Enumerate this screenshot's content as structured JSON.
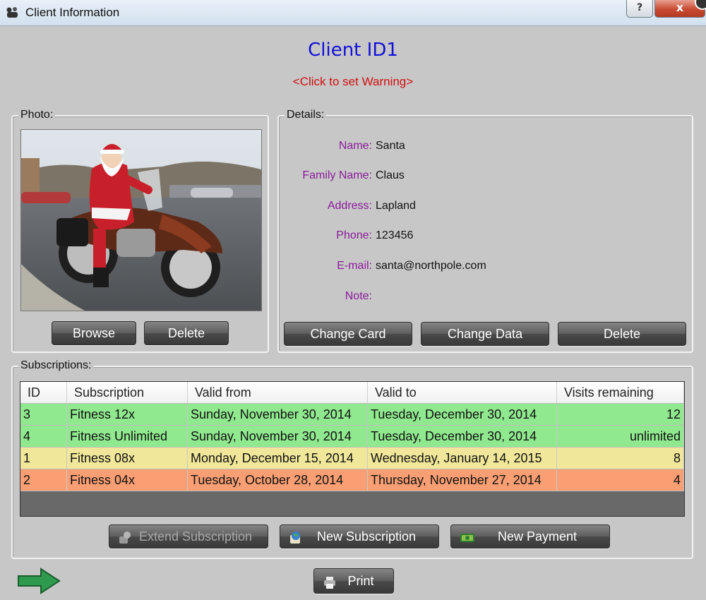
{
  "window": {
    "title": "Client Information",
    "help_label": "?",
    "close_label": "x"
  },
  "client": {
    "title": "Client ID1",
    "warning": "<Click to set Warning>"
  },
  "photo": {
    "legend": "Photo:",
    "browse_label": "Browse",
    "delete_label": "Delete"
  },
  "details": {
    "legend": "Details:",
    "fields": [
      {
        "label": "Name:",
        "value": "Santa"
      },
      {
        "label": "Family Name:",
        "value": "Claus"
      },
      {
        "label": "Address:",
        "value": "Lapland"
      },
      {
        "label": "Phone:",
        "value": "123456"
      },
      {
        "label": "E-mail:",
        "value": "santa@northpole.com"
      },
      {
        "label": "Note:",
        "value": ""
      }
    ],
    "change_card_label": "Change Card",
    "change_data_label": "Change Data",
    "delete_label": "Delete"
  },
  "subscriptions": {
    "legend": "Subscriptions:",
    "columns": [
      "ID",
      "Subscription",
      "Valid from",
      "Valid to",
      "Visits remaining"
    ],
    "rows": [
      {
        "id": "3",
        "subscription": "Fitness 12x",
        "valid_from": "Sunday, November 30, 2014",
        "valid_to": "Tuesday, December 30, 2014",
        "visits": "12",
        "color": "#90e98f"
      },
      {
        "id": "4",
        "subscription": "Fitness Unlimited",
        "valid_from": "Sunday, November 30, 2014",
        "valid_to": "Tuesday, December 30, 2014",
        "visits": "unlimited",
        "color": "#90e98f"
      },
      {
        "id": "1",
        "subscription": "Fitness 08x",
        "valid_from": "Monday, December 15, 2014",
        "valid_to": "Wednesday, January 14, 2015",
        "visits": "8",
        "color": "#f1e79a"
      },
      {
        "id": "2",
        "subscription": "Fitness 04x",
        "valid_from": "Tuesday, October 28, 2014",
        "valid_to": "Thursday, November 27, 2014",
        "visits": "4",
        "color": "#fa9f73"
      }
    ],
    "extend_label": "Extend Subscription",
    "new_subscription_label": "New Subscription",
    "new_payment_label": "New Payment"
  },
  "footer": {
    "print_label": "Print"
  }
}
